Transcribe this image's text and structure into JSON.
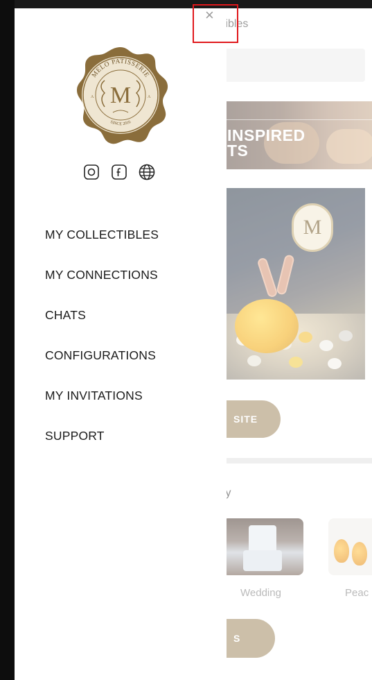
{
  "page": {
    "title_partial": "tibles",
    "banner_line1": "INSPIRED",
    "banner_line2": "TS",
    "site_button_label": "SITE",
    "section_label_partial": "ty",
    "thumbs": [
      {
        "label": "Wedding"
      },
      {
        "label": "Peac"
      }
    ],
    "second_button_label": "S"
  },
  "drawer": {
    "logo": {
      "brand_text": "MELO PATISSERIE",
      "monogram": "M",
      "since": "SINCE 2016"
    },
    "socials": [
      {
        "icon": "instagram-icon"
      },
      {
        "icon": "facebook-icon"
      },
      {
        "icon": "globe-icon"
      }
    ],
    "menu": [
      {
        "label": "MY COLLECTIBLES"
      },
      {
        "label": "MY CONNECTIONS"
      },
      {
        "label": "CHATS"
      },
      {
        "label": "CONFIGURATIONS"
      },
      {
        "label": "MY INVITATIONS"
      },
      {
        "label": "SUPPORT"
      }
    ],
    "close_glyph": "×"
  },
  "colors": {
    "brand_gold": "#a8926b",
    "seal_brown": "#8a6d3b",
    "highlight_red": "#e0171b"
  }
}
